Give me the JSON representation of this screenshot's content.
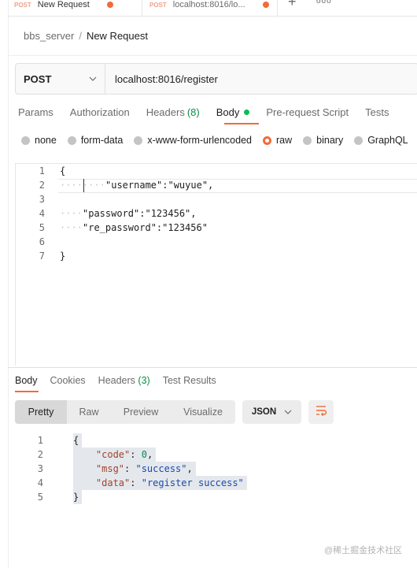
{
  "tabs": [
    {
      "method": "POST",
      "name": "New Request"
    },
    {
      "method": "POST",
      "name": "localhost:8016/lo..."
    }
  ],
  "tab_actions": {
    "add": "+",
    "more": "ooo"
  },
  "breadcrumb": {
    "parent": "bbs_server",
    "separator": "/",
    "current": "New Request"
  },
  "request": {
    "method": "POST",
    "url": "localhost:8016/register"
  },
  "request_tabs": [
    {
      "label": "Params"
    },
    {
      "label": "Authorization"
    },
    {
      "label": "Headers",
      "count": "(8)"
    },
    {
      "label": "Body",
      "active": true
    },
    {
      "label": "Pre-request Script"
    },
    {
      "label": "Tests"
    }
  ],
  "body_types": [
    {
      "label": "none",
      "checked": false
    },
    {
      "label": "form-data",
      "checked": false
    },
    {
      "label": "x-www-form-urlencoded",
      "checked": false
    },
    {
      "label": "raw",
      "checked": true
    },
    {
      "label": "binary",
      "checked": false
    },
    {
      "label": "GraphQL",
      "checked": false
    }
  ],
  "request_body_lines": [
    {
      "num": "1",
      "text": "{"
    },
    {
      "num": "2",
      "text": "\"username\":\"wuyue\","
    },
    {
      "num": "3",
      "text": ""
    },
    {
      "num": "4",
      "text": "\"password\":\"123456\","
    },
    {
      "num": "5",
      "text": "\"re_password\":\"123456\""
    },
    {
      "num": "6",
      "text": ""
    },
    {
      "num": "7",
      "text": "}"
    }
  ],
  "response_tabs": [
    {
      "label": "Body",
      "active": true
    },
    {
      "label": "Cookies"
    },
    {
      "label": "Headers",
      "count": "(3)"
    },
    {
      "label": "Test Results"
    }
  ],
  "view_modes": [
    "Pretty",
    "Raw",
    "Preview",
    "Visualize"
  ],
  "format": "JSON",
  "response_lines": [
    {
      "num": "1",
      "open": "{"
    },
    {
      "num": "2",
      "key": "\"code\"",
      "value": "0",
      "value_type": "number"
    },
    {
      "num": "3",
      "key": "\"msg\"",
      "value": "\"success\"",
      "value_type": "string"
    },
    {
      "num": "4",
      "key": "\"data\"",
      "value": "\"register success\"",
      "value_type": "string",
      "last": true
    },
    {
      "num": "5",
      "open": "}"
    }
  ],
  "watermark": "@稀土掘金技术社区",
  "colors": {
    "accent": "#f26b3a",
    "success_green": "#0cbb52",
    "json_key": "#a3412a",
    "json_string": "#1b4aa8",
    "json_number": "#098658"
  }
}
